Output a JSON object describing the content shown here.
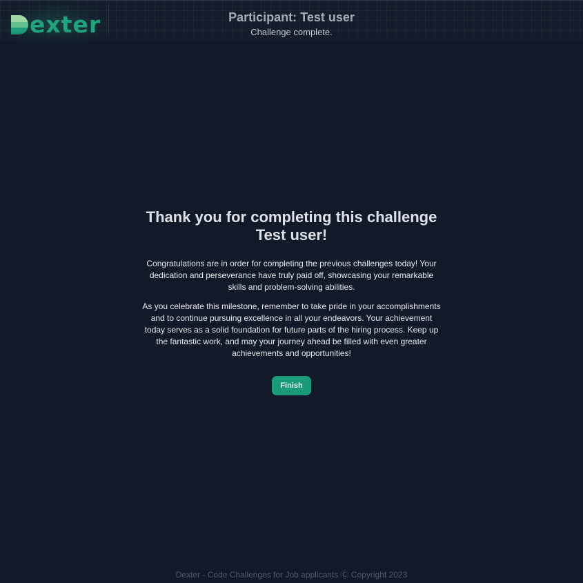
{
  "header": {
    "logo": {
      "text": "exter",
      "icon": "dexter-d-logo-icon",
      "color": "#20a37c",
      "accent_color": "#8fd19a"
    },
    "participant_title": "Participant: Test user",
    "status": "Challenge complete."
  },
  "main": {
    "heading_line1": "Thank you for completing this challenge",
    "heading_line2": "Test user!",
    "paragraph1": "Congratulations are in order for completing the previous challenges today! Your dedication and perseverance have truly paid off, showcasing your remarkable skills and problem-solving abilities.",
    "paragraph2": "As you celebrate this milestone, remember to take pride in your accomplishments and to continue pursuing excellence in all your endeavors. Your achievement today serves as a solid foundation for future parts of the hiring process. Keep up the fantastic work, and may your journey ahead be filled with even greater achievements and opportunities!",
    "finish_button_label": "Finish",
    "button_color": "#1a9a78"
  },
  "footer": {
    "text": "Dexter - Code Challenges for Job applicants Ⓒ Copyright 2023"
  },
  "colors": {
    "background": "#121a2a"
  }
}
